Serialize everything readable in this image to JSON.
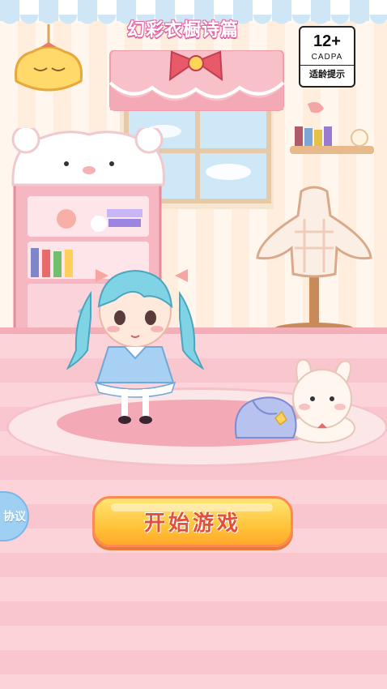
{
  "game": {
    "title": "幻彩衣橱诗篇",
    "start_button_label": "开始游戏",
    "agreement_tab_label": "协议"
  },
  "rating_badge": {
    "age": "12+",
    "org": "CADPA",
    "tip": "适龄提示"
  },
  "colors": {
    "start_button": "#ffc43a",
    "start_text": "#e0503a",
    "agreement_tab": "#9fcff3",
    "title_outline": "#e36aa6",
    "floor": "#fbd3d8"
  }
}
